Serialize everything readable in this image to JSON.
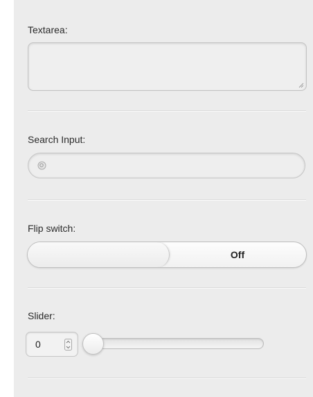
{
  "fields": {
    "textarea": {
      "label": "Textarea:",
      "value": ""
    },
    "search": {
      "label": "Search Input:",
      "value": "",
      "icon": "search-icon"
    },
    "flip_switch": {
      "label": "Flip switch:",
      "state_label": "Off"
    },
    "slider": {
      "label": "Slider:",
      "value": "0",
      "fraction": 0
    }
  },
  "colors": {
    "panel_background": "#ececec",
    "control_border": "#c2c2c2",
    "label_text": "#2a2a2a"
  }
}
